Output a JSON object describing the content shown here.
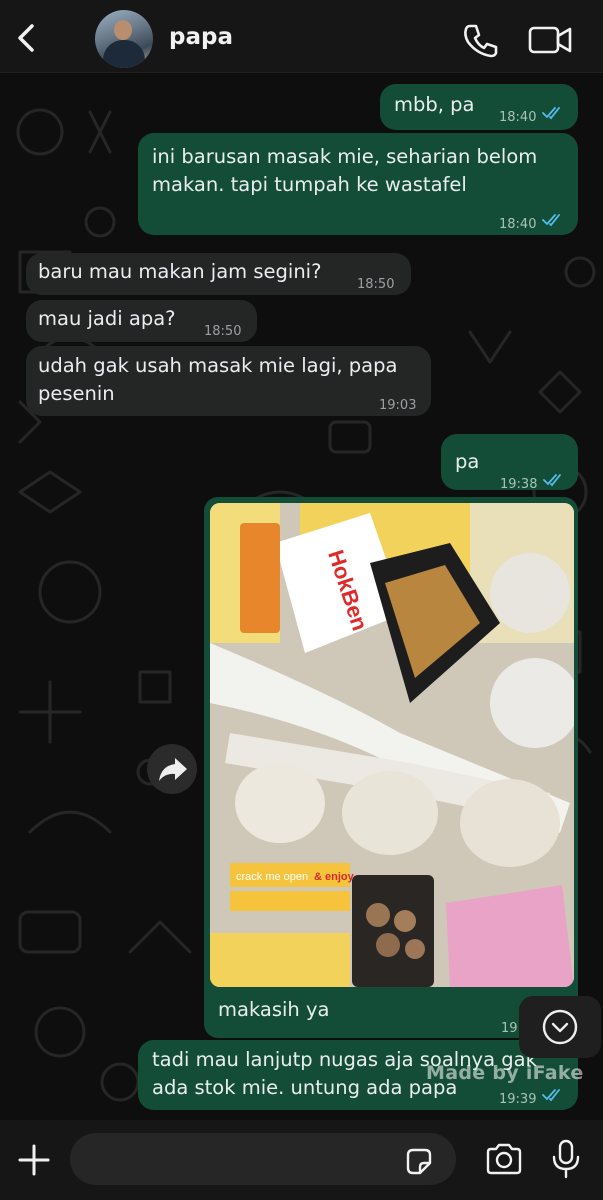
{
  "header": {
    "contact_name": "papa",
    "icons": [
      "back-arrow-icon",
      "phone-icon",
      "video-camera-icon"
    ]
  },
  "messages": [
    {
      "direction": "out",
      "text": "mbb, pa",
      "time": "18:40",
      "read": true
    },
    {
      "direction": "out",
      "text": "ini barusan masak mie, seharian belom\nmakan. tapi tumpah ke wastafel",
      "time": "18:40",
      "read": true
    },
    {
      "direction": "in",
      "text": "baru mau makan jam segini?",
      "time": "18:50"
    },
    {
      "direction": "in",
      "text": "mau jadi apa?",
      "time": "18:50"
    },
    {
      "direction": "in",
      "text": "udah gak usah masak mie lagi, papa\npesenin",
      "time": "19:03"
    },
    {
      "direction": "out",
      "text": "pa",
      "time": "19:38",
      "read": true
    },
    {
      "direction": "out",
      "type": "image",
      "caption": "makasih ya",
      "time": "19",
      "read": true,
      "photo_labels": [
        "HokBen",
        "crack me open",
        "& enjoy"
      ]
    },
    {
      "direction": "out",
      "text": "tadi mau lanjutp nugas aja soalnya gak\nada stok mie. untung ada papa",
      "time": "19:39",
      "read": true
    }
  ],
  "watermark": "Made by iFake",
  "composer": {
    "placeholder": "",
    "icons": [
      "plus-icon",
      "sticker-icon",
      "camera-icon",
      "microphone-icon"
    ]
  },
  "colors": {
    "outgoing_bubble": "#144d37",
    "incoming_bubble": "#242626",
    "read_tick": "#53bdeb",
    "background": "#0e0e0e"
  }
}
